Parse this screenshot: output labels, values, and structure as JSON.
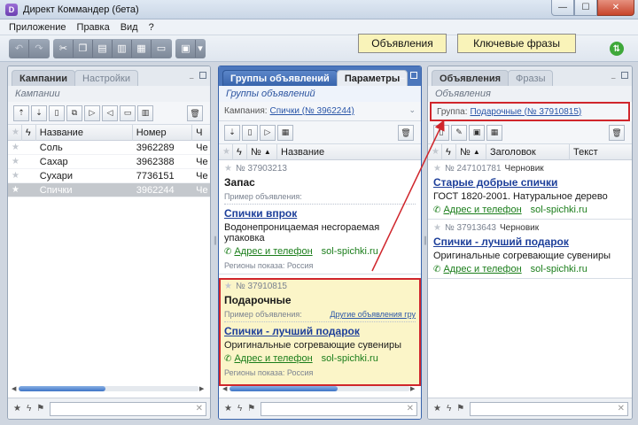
{
  "window": {
    "title": "Директ Коммандер (бета)",
    "icon_letter": "D",
    "minimize": "—",
    "maximize": "☐",
    "close": "✕"
  },
  "menu": [
    "Приложение",
    "Правка",
    "Вид",
    "?"
  ],
  "callouts": {
    "ads": "Объявления",
    "keywords": "Ключевые фразы"
  },
  "left_panel": {
    "tabs": [
      "Кампании",
      "Настройки"
    ],
    "subtitle": "Кампании",
    "columns": [
      "Название",
      "Номер",
      "Ч"
    ],
    "rows": [
      {
        "name": "Соль",
        "number": "3962289",
        "extra": "Че",
        "selected": false
      },
      {
        "name": "Сахар",
        "number": "3962388",
        "extra": "Че",
        "selected": false
      },
      {
        "name": "Сухари",
        "number": "7736151",
        "extra": "Че",
        "selected": false
      },
      {
        "name": "Спички",
        "number": "3962244",
        "extra": "Че",
        "selected": true
      }
    ]
  },
  "mid_panel": {
    "tabs": [
      "Группы объявлений",
      "Параметры"
    ],
    "subtitle": "Группы объявлений",
    "context_label": "Кампания:",
    "context_value": "Спички (№ 3962244)",
    "columns": [
      "№",
      "Название"
    ],
    "groups": [
      {
        "number": "№ 37903213",
        "name": "Запас",
        "example_label": "Пример объявления:",
        "other_link": "",
        "ad_title": "Спички впрок",
        "ad_text": "Водонепроницаемая несгораемая упаковка",
        "addr": "Адрес и телефон",
        "site": "sol-spichki.ru",
        "regions": "Регионы показа: Россия"
      },
      {
        "number": "№ 37910815",
        "name": "Подарочные",
        "example_label": "Пример объявления:",
        "other_link": "Другие объявления гру",
        "ad_title": "Спички - лучший подарок",
        "ad_text": "Оригинальные согревающие сувениры",
        "addr": "Адрес и телефон",
        "site": "sol-spichki.ru",
        "regions": "Регионы показа: Россия"
      }
    ]
  },
  "right_panel": {
    "tabs": [
      "Объявления",
      "Фразы"
    ],
    "subtitle": "Объявления",
    "context_label": "Группа:",
    "context_value": "Подарочные (№ 37910815)",
    "columns": [
      "№",
      "Заголовок",
      "Текст"
    ],
    "ads": [
      {
        "number": "№ 247101781",
        "status": "Черновик",
        "title": "Старые добрые спички",
        "text": "ГОСТ 1820-2001. Натуральное дерево",
        "addr": "Адрес и телефон",
        "site": "sol-spichki.ru"
      },
      {
        "number": "№ 37913643",
        "status": "Черновик",
        "title": "Спички - лучший подарок",
        "text": "Оригинальные согревающие сувениры",
        "addr": "Адрес и телефон",
        "site": "sol-spichki.ru"
      }
    ]
  },
  "colors": {
    "accent_blue": "#3864ac",
    "highlight_red": "#d0262c",
    "selected_yellow": "#fbf5c8",
    "link_green": "#1a7d1a"
  }
}
